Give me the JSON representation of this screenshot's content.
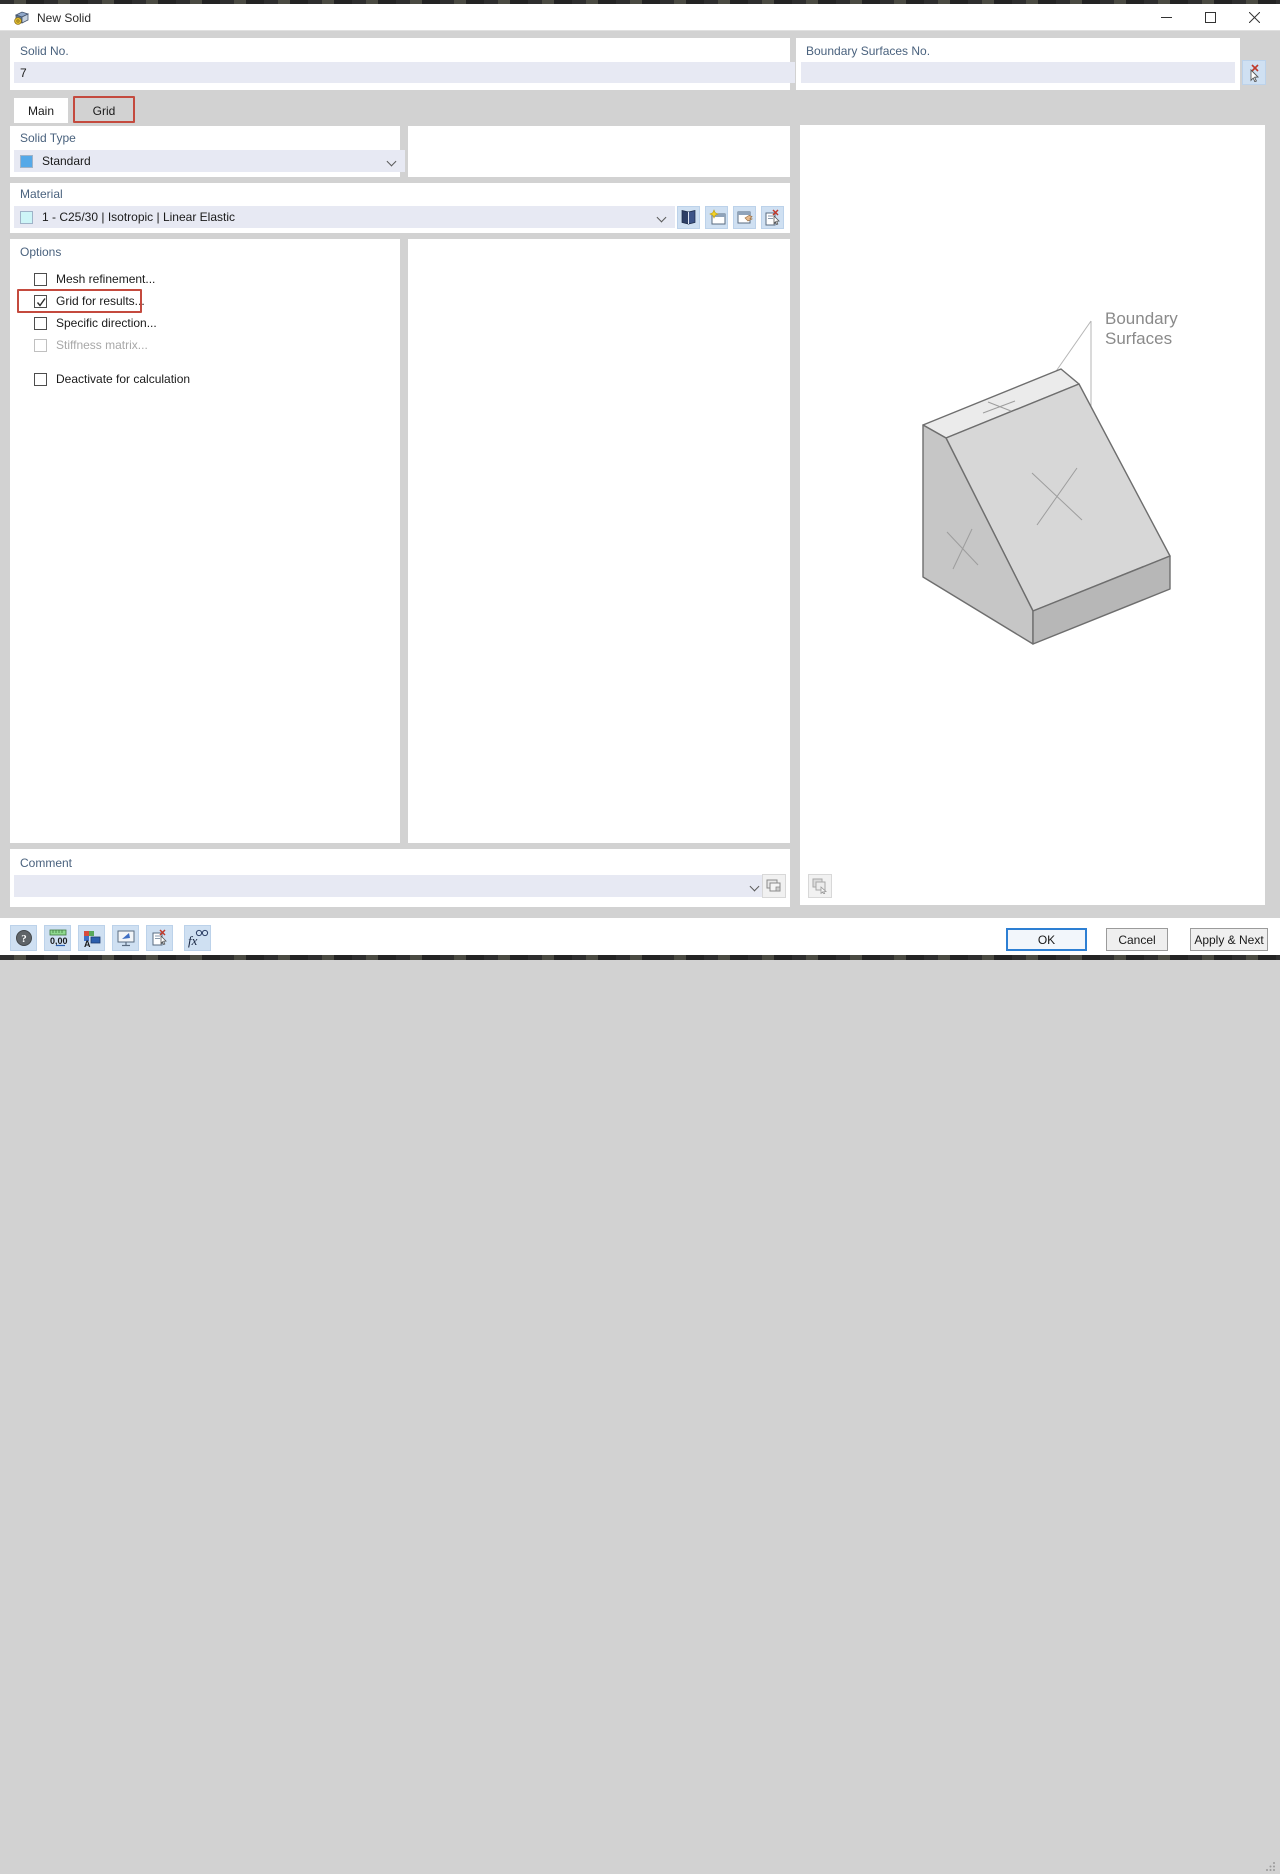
{
  "window": {
    "title": "New Solid"
  },
  "solid_no": {
    "label": "Solid No.",
    "value": "7"
  },
  "boundary_no": {
    "label": "Boundary Surfaces No.",
    "value": ""
  },
  "tabs": {
    "main": "Main",
    "grid": "Grid"
  },
  "solid_type": {
    "label": "Solid Type",
    "value": "Standard",
    "swatch_color": "#55a9e8"
  },
  "material": {
    "label": "Material",
    "value": "1 - C25/30 | Isotropic | Linear Elastic",
    "swatch_color": "#cdf5f7"
  },
  "options": {
    "label": "Options",
    "items": [
      {
        "label": "Mesh refinement...",
        "checked": false,
        "disabled": false
      },
      {
        "label": "Grid for results...",
        "checked": true,
        "disabled": false,
        "annotated": true
      },
      {
        "label": "Specific direction...",
        "checked": false,
        "disabled": false
      },
      {
        "label": "Stiffness matrix...",
        "checked": false,
        "disabled": true
      },
      {
        "label": "Deactivate for calculation",
        "checked": false,
        "disabled": false
      }
    ]
  },
  "preview": {
    "annotation_line1": "Boundary",
    "annotation_line2": "Surfaces"
  },
  "comment": {
    "label": "Comment",
    "value": ""
  },
  "footer": {
    "ok": "OK",
    "cancel": "Cancel",
    "apply_next": "Apply & Next",
    "units_sample": "0,00",
    "fx_label": "fx",
    "toolbar_icon_names": [
      "help-icon",
      "units-icon",
      "display-settings-icon",
      "monitor-icon",
      "delete-selection-icon",
      "formula-icon"
    ]
  },
  "colors": {
    "accent_blue": "#2d7fd3",
    "annotation_red": "#c44a3e",
    "field_bg": "#e7e9f3",
    "toolbar_btn_bg": "#cfe0f2",
    "label_blue": "#4a627e"
  }
}
